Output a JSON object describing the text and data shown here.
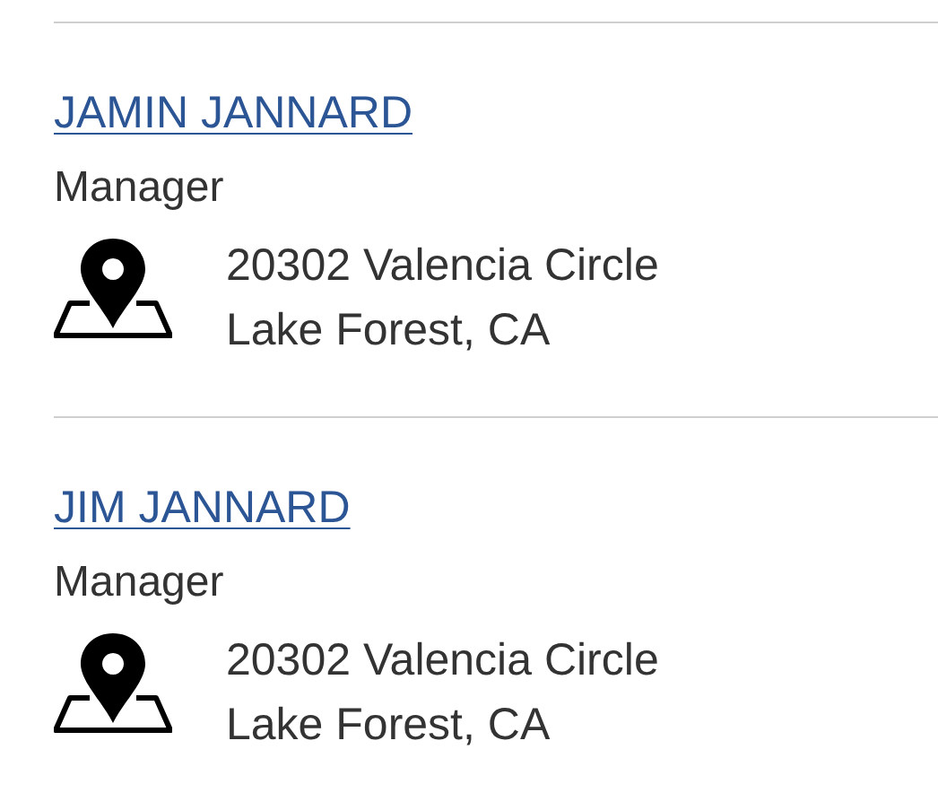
{
  "contacts": [
    {
      "name": "JAMIN JANNARD",
      "role": "Manager",
      "address": [
        "20302 Valencia Circle",
        "Lake Forest, CA"
      ]
    },
    {
      "name": "JIM JANNARD",
      "role": "Manager",
      "address": [
        "20302 Valencia Circle",
        "Lake Forest, CA"
      ]
    }
  ]
}
